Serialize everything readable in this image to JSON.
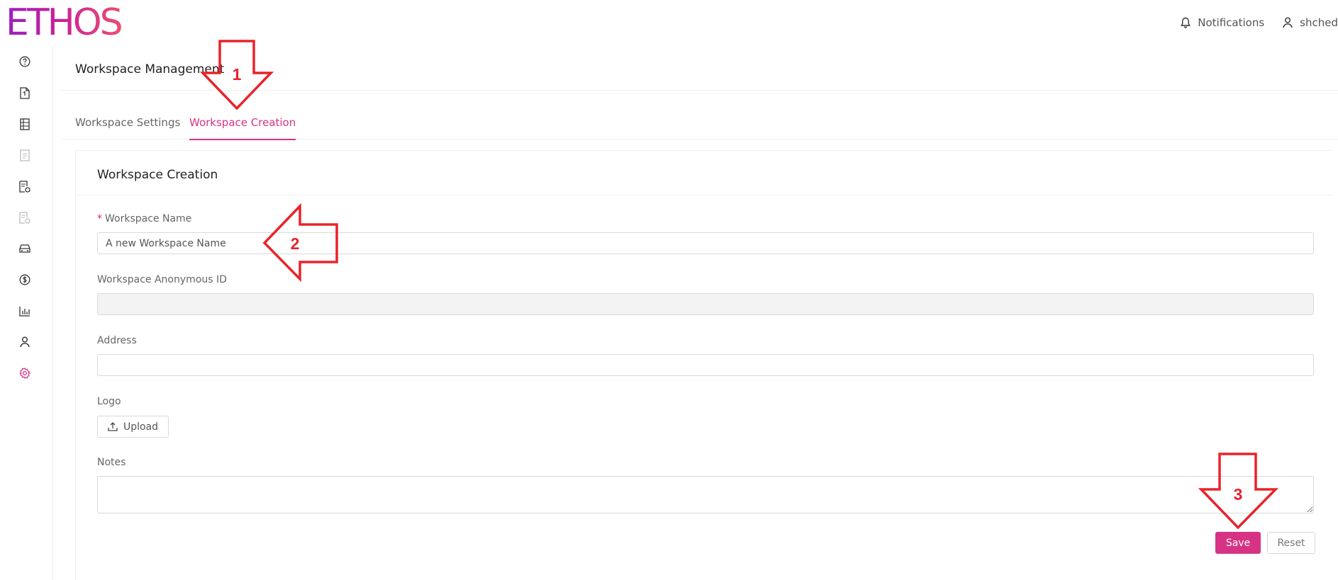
{
  "brand": {
    "logo_text": "ETHOS"
  },
  "topbar": {
    "notifications_label": "Notifications",
    "user_label": "shched"
  },
  "sidebar": {
    "icons": [
      "help-icon",
      "document-icon",
      "ledger-icon",
      "receipt-icon",
      "document-settings-icon",
      "report-icon",
      "car-icon",
      "dollar-icon",
      "bar-chart-icon",
      "user-icon",
      "gear-icon"
    ],
    "active_color": "#d63384"
  },
  "page": {
    "title": "Workspace Management"
  },
  "tabs": [
    {
      "label": "Workspace Settings",
      "active": false
    },
    {
      "label": "Workspace Creation",
      "active": true
    }
  ],
  "form": {
    "card_title": "Workspace Creation",
    "required_mark": "*",
    "workspace_name_label": "Workspace Name",
    "workspace_name_placeholder": "A new Workspace Name",
    "anon_id_label": "Workspace Anonymous ID",
    "address_label": "Address",
    "logo_label": "Logo",
    "upload_label": "Upload",
    "notes_label": "Notes",
    "save_label": "Save",
    "reset_label": "Reset"
  },
  "callouts": [
    {
      "number": "1",
      "direction": "down"
    },
    {
      "number": "2",
      "direction": "left"
    },
    {
      "number": "3",
      "direction": "down"
    }
  ],
  "colors": {
    "accent": "#d63384",
    "callout": "#e8232b"
  }
}
